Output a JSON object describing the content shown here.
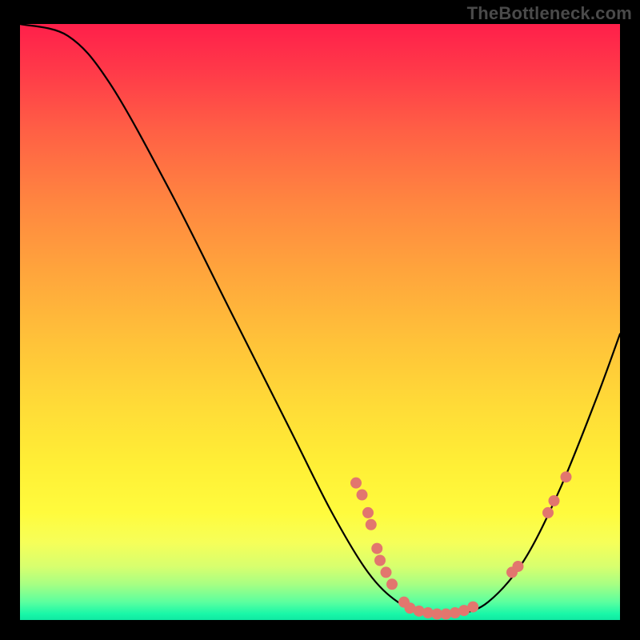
{
  "attribution": "TheBottleneck.com",
  "colors": {
    "background": "#000000",
    "curve_stroke": "#000000",
    "marker_fill": "#e2766e",
    "attribution_text": "#4a4a4a"
  },
  "chart_data": {
    "type": "line",
    "title": "",
    "xlabel": "",
    "ylabel": "",
    "xlim": [
      0,
      100
    ],
    "ylim": [
      0,
      100
    ],
    "note": "Axes are unlabeled in the image; x/y values below are read off the plot area as percentages (0–100).",
    "curve": [
      {
        "x": 0,
        "y": 100
      },
      {
        "x": 8,
        "y": 98
      },
      {
        "x": 15,
        "y": 90
      },
      {
        "x": 25,
        "y": 72
      },
      {
        "x": 35,
        "y": 52
      },
      {
        "x": 45,
        "y": 32
      },
      {
        "x": 52,
        "y": 18
      },
      {
        "x": 58,
        "y": 8
      },
      {
        "x": 63,
        "y": 3
      },
      {
        "x": 68,
        "y": 1
      },
      {
        "x": 73,
        "y": 1
      },
      {
        "x": 78,
        "y": 3
      },
      {
        "x": 84,
        "y": 10
      },
      {
        "x": 90,
        "y": 22
      },
      {
        "x": 96,
        "y": 37
      },
      {
        "x": 100,
        "y": 48
      }
    ],
    "markers": [
      {
        "x": 56,
        "y": 23
      },
      {
        "x": 57,
        "y": 21
      },
      {
        "x": 58,
        "y": 18
      },
      {
        "x": 58.5,
        "y": 16
      },
      {
        "x": 59.5,
        "y": 12
      },
      {
        "x": 60,
        "y": 10
      },
      {
        "x": 61,
        "y": 8
      },
      {
        "x": 62,
        "y": 6
      },
      {
        "x": 64,
        "y": 3
      },
      {
        "x": 65,
        "y": 2
      },
      {
        "x": 66.5,
        "y": 1.5
      },
      {
        "x": 68,
        "y": 1.2
      },
      {
        "x": 69.5,
        "y": 1
      },
      {
        "x": 71,
        "y": 1
      },
      {
        "x": 72.5,
        "y": 1.2
      },
      {
        "x": 74,
        "y": 1.6
      },
      {
        "x": 75.5,
        "y": 2.2
      },
      {
        "x": 82,
        "y": 8
      },
      {
        "x": 83,
        "y": 9
      },
      {
        "x": 88,
        "y": 18
      },
      {
        "x": 89,
        "y": 20
      },
      {
        "x": 91,
        "y": 24
      }
    ]
  }
}
